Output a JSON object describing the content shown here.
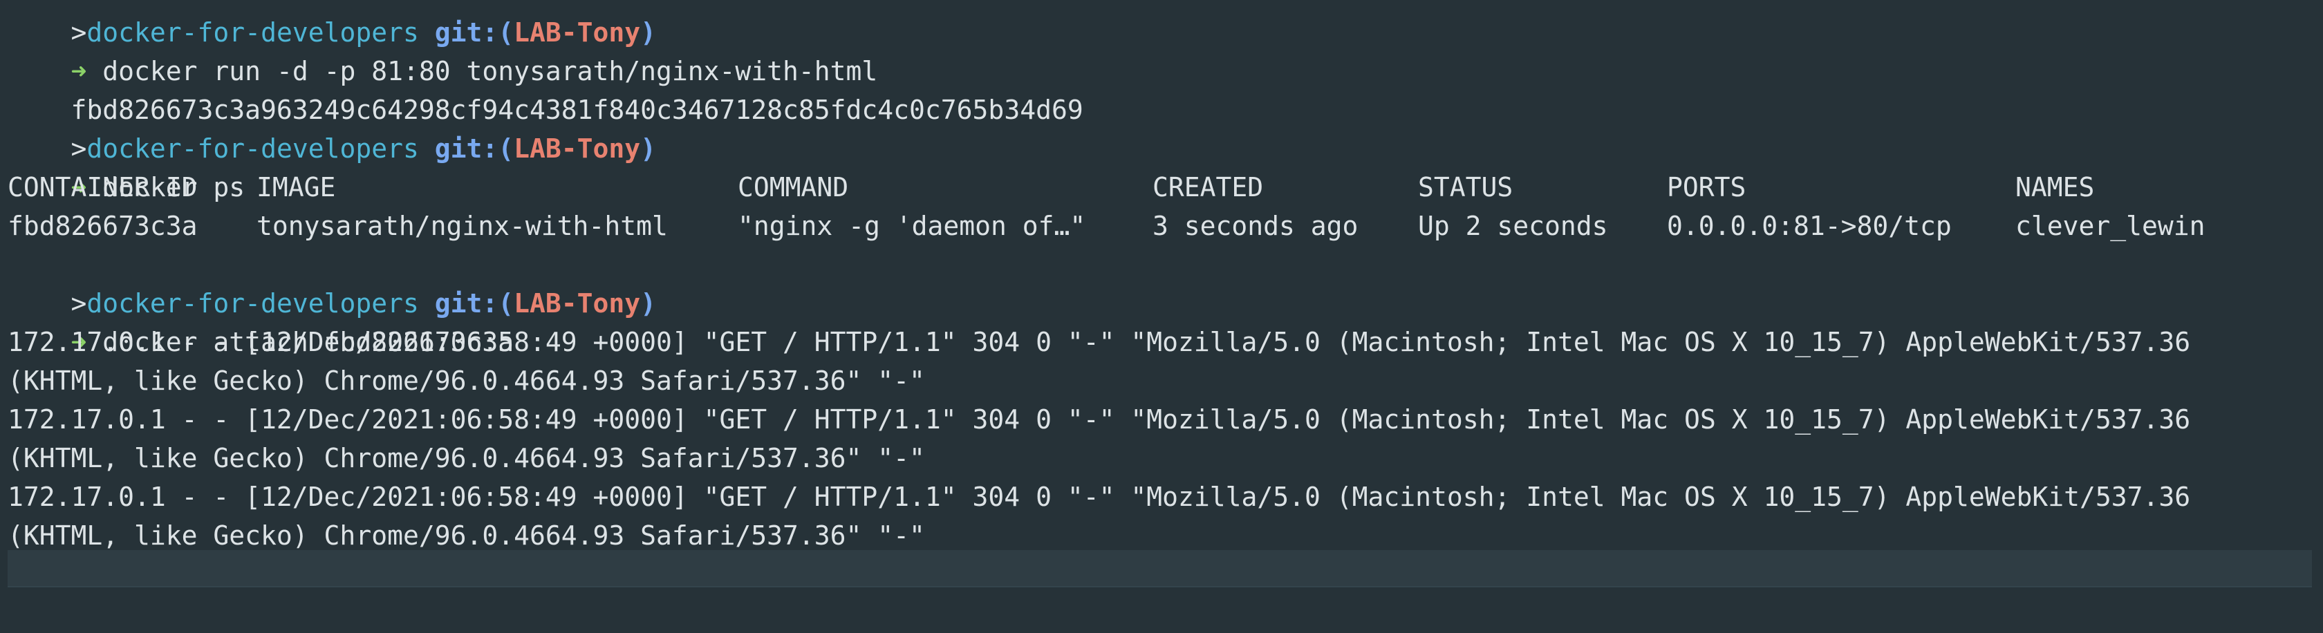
{
  "prompt": {
    "arrow": "➜",
    "gt": ">",
    "dir": "docker-for-developers",
    "git_label": "git:",
    "paren_open": "(",
    "branch": "LAB-Tony",
    "paren_close": ")"
  },
  "commands": {
    "partial_top": "...",
    "run": " docker run -d -p 81:80 tonysarath/nginx-with-html",
    "container_hash": "fbd826673c3a963249c64298cf94c4381f840c3467128c85fdc4c0c765b34d69",
    "ps": " docker ps",
    "attach": " docker attach fbd826673c3a"
  },
  "ps_table": {
    "headers": [
      "CONTAINER ID",
      "IMAGE",
      "COMMAND",
      "CREATED",
      "STATUS",
      "PORTS",
      "NAMES"
    ],
    "rows": [
      [
        "fbd826673c3a",
        "tonysarath/nginx-with-html",
        "\"nginx -g 'daemon of…\"",
        "3 seconds ago",
        "Up 2 seconds",
        "0.0.0.0:81->80/tcp",
        "clever_lewin"
      ]
    ]
  },
  "logs": [
    {
      "line1": "172.17.0.1 - - [12/Dec/2021:06:58:49 +0000] \"GET / HTTP/1.1\" 304 0 \"-\" \"Mozilla/5.0 (Macintosh; Intel Mac OS X 10_15_7) AppleWebKit/537.36",
      "line2": "(KHTML, like Gecko) Chrome/96.0.4664.93 Safari/537.36\" \"-\""
    },
    {
      "line1": "172.17.0.1 - - [12/Dec/2021:06:58:49 +0000] \"GET / HTTP/1.1\" 304 0 \"-\" \"Mozilla/5.0 (Macintosh; Intel Mac OS X 10_15_7) AppleWebKit/537.36",
      "line2": "(KHTML, like Gecko) Chrome/96.0.4664.93 Safari/537.36\" \"-\""
    },
    {
      "line1": "172.17.0.1 - - [12/Dec/2021:06:58:49 +0000] \"GET / HTTP/1.1\" 304 0 \"-\" \"Mozilla/5.0 (Macintosh; Intel Mac OS X 10_15_7) AppleWebKit/537.36",
      "line2": "(KHTML, like Gecko) Chrome/96.0.4664.93 Safari/537.36\" \"-\""
    }
  ],
  "colors": {
    "background": "#263238",
    "text": "#dde3e6",
    "arrow": "#8bd168",
    "directory": "#4fb6d6",
    "git": "#79a9f0",
    "branch": "#e88270",
    "cursor_line": "#2f3d44"
  }
}
